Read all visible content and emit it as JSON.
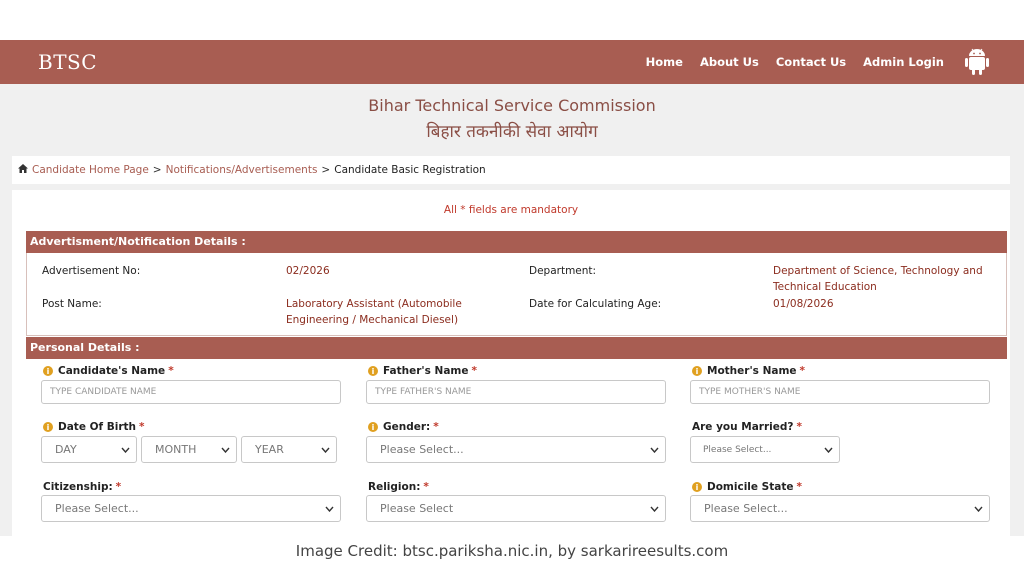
{
  "nav": {
    "logo": "BTSC",
    "links": [
      "Home",
      "About Us",
      "Contact Us",
      "Admin Login"
    ]
  },
  "header": {
    "title_en": "Bihar Technical Service Commission",
    "title_hi": "बिहार तकनीकी सेवा आयोग"
  },
  "breadcrumb": {
    "home": "Candidate Home Page",
    "link2": "Notifications/Advertisements",
    "current": "Candidate Basic Registration",
    "sep": ">"
  },
  "form": {
    "mandatory_note": "All * fields are mandatory",
    "advert_section": {
      "title": "Advertisment/Notification Details :",
      "adv_no_label": "Advertisement No:",
      "adv_no_value": "02/2026",
      "department_label": "Department:",
      "department_value": "Department of Science, Technology and Technical Education",
      "post_label": "Post Name:",
      "post_value": "Laboratory Assistant (Automobile Engineering / Mechanical Diesel)",
      "age_date_label": "Date for Calculating Age:",
      "age_date_value": "01/08/2026"
    },
    "personal_section": {
      "title": "Personal Details :",
      "candidate_name_label": "Candidate's Name",
      "candidate_name_placeholder": "TYPE CANDIDATE NAME",
      "father_name_label": "Father's Name",
      "father_name_placeholder": "TYPE FATHER'S NAME",
      "mother_name_label": "Mother's Name",
      "mother_name_placeholder": "TYPE MOTHER'S NAME",
      "dob_label": "Date Of Birth",
      "dob_day": "DAY",
      "dob_month": "MONTH",
      "dob_year": "YEAR",
      "gender_label": "Gender:",
      "gender_value": "Please Select...",
      "married_label": "Are you Married?",
      "married_value": "Please Select...",
      "citizenship_label": "Citizenship:",
      "citizenship_value": "Please Select...",
      "religion_label": "Religion:",
      "religion_value": "Please Select",
      "domicile_label": "Domicile State",
      "domicile_value": "Please Select...",
      "required_mark": "*"
    }
  },
  "credit": "Image Credit: btsc.pariksha.nic.in, by sarkarireesults.com",
  "colors": {
    "brand": "#a85d52",
    "value_text": "#8b2c1e",
    "required": "#c0392b",
    "info": "#e0a020"
  }
}
